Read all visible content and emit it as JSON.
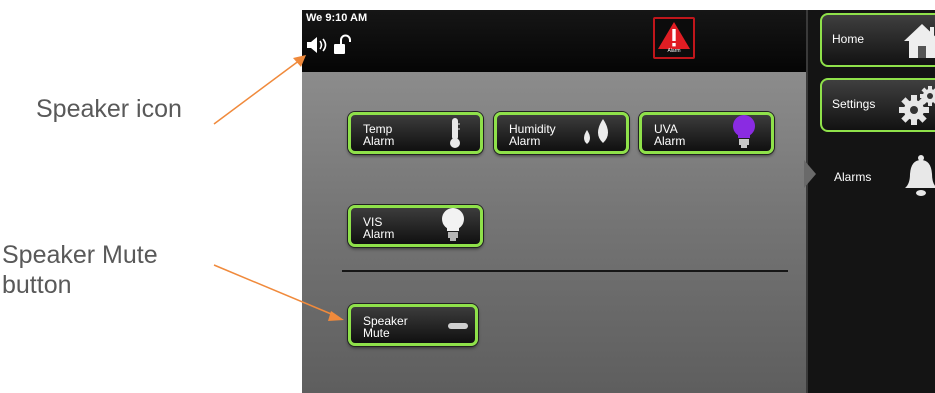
{
  "callouts": {
    "speaker_icon_label": "Speaker icon",
    "mute_label_line1": "Speaker Mute",
    "mute_label_line2": "button"
  },
  "status_bar": {
    "time": "We 9:10 AM",
    "alert_label": "Alarm"
  },
  "alarm_buttons": [
    {
      "line1": "Temp",
      "line2": "Alarm",
      "icon": "thermometer-icon"
    },
    {
      "line1": "Humidity",
      "line2": "Alarm",
      "icon": "water-drops-icon"
    },
    {
      "line1": "UVA",
      "line2": "Alarm",
      "icon": "purple-bulb-icon"
    },
    {
      "line1": "VIS",
      "line2": "Alarm",
      "icon": "white-bulb-icon"
    }
  ],
  "mute_button": {
    "line1": "Speaker",
    "line2": "Mute",
    "icon": "toggle-slot-icon"
  },
  "side_nav": {
    "home": {
      "label": "Home",
      "icon": "house-icon"
    },
    "settings": {
      "label": "Settings",
      "icon": "gears-icon"
    },
    "alarms": {
      "label": "Alarms",
      "icon": "bell-icon"
    }
  },
  "colors": {
    "button_border": "#8fe14a",
    "arrow": "#f08a3c",
    "alert_red": "#c0161b",
    "uva_bulb": "#8a2be2"
  }
}
